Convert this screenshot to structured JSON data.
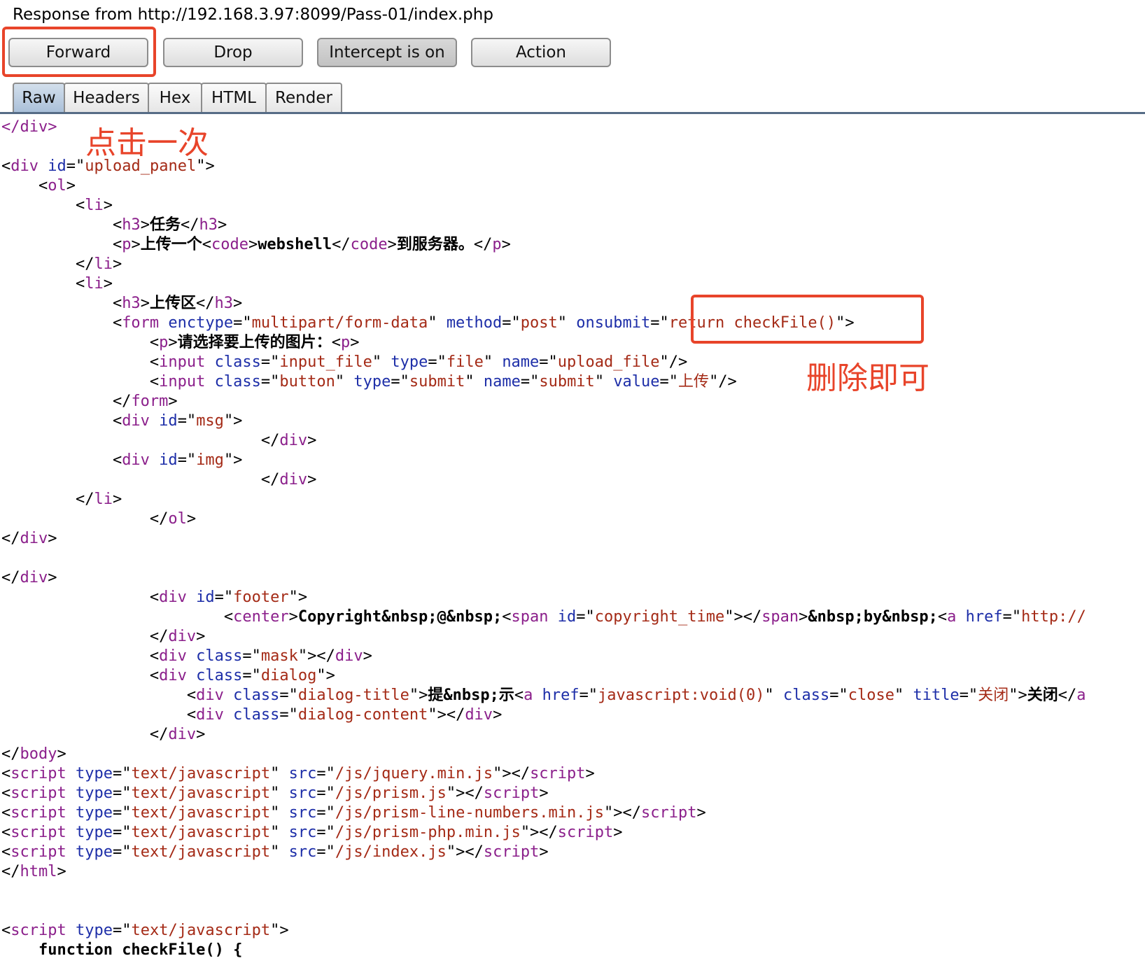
{
  "header": {
    "title": "Response from http://192.168.3.97:8099/Pass-01/index.php"
  },
  "toolbar": {
    "forward": "Forward",
    "drop": "Drop",
    "intercept": "Intercept is on",
    "action": "Action"
  },
  "tabs": [
    "Raw",
    "Headers",
    "Hex",
    "HTML",
    "Render"
  ],
  "annotations": {
    "click_once": "点击一次",
    "delete_it": "删除即可"
  },
  "colors": {
    "tag": "#8b1f8b",
    "attr": "#1d2ea8",
    "value": "#a42a16",
    "annotation": "#e8442a",
    "tab_active": "#aac0d9"
  },
  "code_lines": [
    [
      [
        "tg",
        "</div>"
      ]
    ],
    [],
    [
      [
        "pl",
        "<"
      ],
      [
        "tg",
        "div"
      ],
      [
        "pl",
        " "
      ],
      [
        "at",
        "id"
      ],
      [
        "pl",
        "=\""
      ],
      [
        "vl",
        "upload_panel"
      ],
      [
        "pl",
        "\">"
      ]
    ],
    [
      [
        "pl",
        "    <"
      ],
      [
        "tg",
        "ol"
      ],
      [
        "pl",
        ">"
      ]
    ],
    [
      [
        "pl",
        "        <"
      ],
      [
        "tg",
        "li"
      ],
      [
        "pl",
        ">"
      ]
    ],
    [
      [
        "pl",
        "            <"
      ],
      [
        "tg",
        "h3"
      ],
      [
        "pl",
        ">"
      ],
      [
        "tx",
        "任务"
      ],
      [
        "pl",
        "</"
      ],
      [
        "tg",
        "h3"
      ],
      [
        "pl",
        ">"
      ]
    ],
    [
      [
        "pl",
        "            <"
      ],
      [
        "tg",
        "p"
      ],
      [
        "pl",
        ">"
      ],
      [
        "tx",
        "上传一个"
      ],
      [
        "pl",
        "<"
      ],
      [
        "tg",
        "code"
      ],
      [
        "pl",
        ">"
      ],
      [
        "tx",
        "webshell"
      ],
      [
        "pl",
        "</"
      ],
      [
        "tg",
        "code"
      ],
      [
        "pl",
        ">"
      ],
      [
        "tx",
        "到服务器。"
      ],
      [
        "pl",
        "</"
      ],
      [
        "tg",
        "p"
      ],
      [
        "pl",
        ">"
      ]
    ],
    [
      [
        "pl",
        "        </"
      ],
      [
        "tg",
        "li"
      ],
      [
        "pl",
        ">"
      ]
    ],
    [
      [
        "pl",
        "        <"
      ],
      [
        "tg",
        "li"
      ],
      [
        "pl",
        ">"
      ]
    ],
    [
      [
        "pl",
        "            <"
      ],
      [
        "tg",
        "h3"
      ],
      [
        "pl",
        ">"
      ],
      [
        "tx",
        "上传区"
      ],
      [
        "pl",
        "</"
      ],
      [
        "tg",
        "h3"
      ],
      [
        "pl",
        ">"
      ]
    ],
    [
      [
        "pl",
        "            <"
      ],
      [
        "tg",
        "form"
      ],
      [
        "pl",
        " "
      ],
      [
        "at",
        "enctype"
      ],
      [
        "pl",
        "=\""
      ],
      [
        "vl",
        "multipart/form-data"
      ],
      [
        "pl",
        "\" "
      ],
      [
        "at",
        "method"
      ],
      [
        "pl",
        "=\""
      ],
      [
        "vl",
        "post"
      ],
      [
        "pl",
        "\" "
      ],
      [
        "at",
        "onsubmit"
      ],
      [
        "pl",
        "=\""
      ],
      [
        "vl",
        "return checkFile()"
      ],
      [
        "pl",
        "\">"
      ]
    ],
    [
      [
        "pl",
        "                <"
      ],
      [
        "tg",
        "p"
      ],
      [
        "pl",
        ">"
      ],
      [
        "tx",
        "请选择要上传的图片："
      ],
      [
        "pl",
        "<"
      ],
      [
        "tg",
        "p"
      ],
      [
        "pl",
        ">"
      ]
    ],
    [
      [
        "pl",
        "                <"
      ],
      [
        "tg",
        "input"
      ],
      [
        "pl",
        " "
      ],
      [
        "at",
        "class"
      ],
      [
        "pl",
        "=\""
      ],
      [
        "vl",
        "input_file"
      ],
      [
        "pl",
        "\" "
      ],
      [
        "at",
        "type"
      ],
      [
        "pl",
        "=\""
      ],
      [
        "vl",
        "file"
      ],
      [
        "pl",
        "\" "
      ],
      [
        "at",
        "name"
      ],
      [
        "pl",
        "=\""
      ],
      [
        "vl",
        "upload_file"
      ],
      [
        "pl",
        "\"/>"
      ]
    ],
    [
      [
        "pl",
        "                <"
      ],
      [
        "tg",
        "input"
      ],
      [
        "pl",
        " "
      ],
      [
        "at",
        "class"
      ],
      [
        "pl",
        "=\""
      ],
      [
        "vl",
        "button"
      ],
      [
        "pl",
        "\" "
      ],
      [
        "at",
        "type"
      ],
      [
        "pl",
        "=\""
      ],
      [
        "vl",
        "submit"
      ],
      [
        "pl",
        "\" "
      ],
      [
        "at",
        "name"
      ],
      [
        "pl",
        "=\""
      ],
      [
        "vl",
        "submit"
      ],
      [
        "pl",
        "\" "
      ],
      [
        "at",
        "value"
      ],
      [
        "pl",
        "=\""
      ],
      [
        "vl",
        "上传"
      ],
      [
        "pl",
        "\"/>"
      ]
    ],
    [
      [
        "pl",
        "            </"
      ],
      [
        "tg",
        "form"
      ],
      [
        "pl",
        ">"
      ]
    ],
    [
      [
        "pl",
        "            <"
      ],
      [
        "tg",
        "div"
      ],
      [
        "pl",
        " "
      ],
      [
        "at",
        "id"
      ],
      [
        "pl",
        "=\""
      ],
      [
        "vl",
        "msg"
      ],
      [
        "pl",
        "\">"
      ]
    ],
    [
      [
        "pl",
        "                            </"
      ],
      [
        "tg",
        "div"
      ],
      [
        "pl",
        ">"
      ]
    ],
    [
      [
        "pl",
        "            <"
      ],
      [
        "tg",
        "div"
      ],
      [
        "pl",
        " "
      ],
      [
        "at",
        "id"
      ],
      [
        "pl",
        "=\""
      ],
      [
        "vl",
        "img"
      ],
      [
        "pl",
        "\">"
      ]
    ],
    [
      [
        "pl",
        "                            </"
      ],
      [
        "tg",
        "div"
      ],
      [
        "pl",
        ">"
      ]
    ],
    [
      [
        "pl",
        "        </"
      ],
      [
        "tg",
        "li"
      ],
      [
        "pl",
        ">"
      ]
    ],
    [
      [
        "pl",
        "                </"
      ],
      [
        "tg",
        "ol"
      ],
      [
        "pl",
        ">"
      ]
    ],
    [
      [
        "pl",
        "</"
      ],
      [
        "tg",
        "div"
      ],
      [
        "pl",
        ">"
      ]
    ],
    [],
    [
      [
        "pl",
        "</"
      ],
      [
        "tg",
        "div"
      ],
      [
        "pl",
        ">"
      ]
    ],
    [
      [
        "pl",
        "                <"
      ],
      [
        "tg",
        "div"
      ],
      [
        "pl",
        " "
      ],
      [
        "at",
        "id"
      ],
      [
        "pl",
        "=\""
      ],
      [
        "vl",
        "footer"
      ],
      [
        "pl",
        "\">"
      ]
    ],
    [
      [
        "pl",
        "                        <"
      ],
      [
        "tg",
        "center"
      ],
      [
        "pl",
        ">"
      ],
      [
        "tx",
        "Copyright&nbsp;@&nbsp;"
      ],
      [
        "pl",
        "<"
      ],
      [
        "tg",
        "span"
      ],
      [
        "pl",
        " "
      ],
      [
        "at",
        "id"
      ],
      [
        "pl",
        "=\""
      ],
      [
        "vl",
        "copyright_time"
      ],
      [
        "pl",
        "\"></"
      ],
      [
        "tg",
        "span"
      ],
      [
        "pl",
        ">"
      ],
      [
        "tx",
        "&nbsp;by&nbsp;"
      ],
      [
        "pl",
        "<"
      ],
      [
        "tg",
        "a"
      ],
      [
        "pl",
        " "
      ],
      [
        "at",
        "href"
      ],
      [
        "pl",
        "=\""
      ],
      [
        "vl",
        "http://"
      ]
    ],
    [
      [
        "pl",
        "                </"
      ],
      [
        "tg",
        "div"
      ],
      [
        "pl",
        ">"
      ]
    ],
    [
      [
        "pl",
        "                <"
      ],
      [
        "tg",
        "div"
      ],
      [
        "pl",
        " "
      ],
      [
        "at",
        "class"
      ],
      [
        "pl",
        "=\""
      ],
      [
        "vl",
        "mask"
      ],
      [
        "pl",
        "\"></"
      ],
      [
        "tg",
        "div"
      ],
      [
        "pl",
        ">"
      ]
    ],
    [
      [
        "pl",
        "                <"
      ],
      [
        "tg",
        "div"
      ],
      [
        "pl",
        " "
      ],
      [
        "at",
        "class"
      ],
      [
        "pl",
        "=\""
      ],
      [
        "vl",
        "dialog"
      ],
      [
        "pl",
        "\">"
      ]
    ],
    [
      [
        "pl",
        "                    <"
      ],
      [
        "tg",
        "div"
      ],
      [
        "pl",
        " "
      ],
      [
        "at",
        "class"
      ],
      [
        "pl",
        "=\""
      ],
      [
        "vl",
        "dialog-title"
      ],
      [
        "pl",
        "\">"
      ],
      [
        "tx",
        "提&nbsp;示"
      ],
      [
        "pl",
        "<"
      ],
      [
        "tg",
        "a"
      ],
      [
        "pl",
        " "
      ],
      [
        "at",
        "href"
      ],
      [
        "pl",
        "=\""
      ],
      [
        "vl",
        "javascript:void(0)"
      ],
      [
        "pl",
        "\" "
      ],
      [
        "at",
        "class"
      ],
      [
        "pl",
        "=\""
      ],
      [
        "vl",
        "close"
      ],
      [
        "pl",
        "\" "
      ],
      [
        "at",
        "title"
      ],
      [
        "pl",
        "=\""
      ],
      [
        "vl",
        "关闭"
      ],
      [
        "pl",
        "\">"
      ],
      [
        "tx",
        "关闭"
      ],
      [
        "pl",
        "</"
      ],
      [
        "tg",
        "a"
      ]
    ],
    [
      [
        "pl",
        "                    <"
      ],
      [
        "tg",
        "div"
      ],
      [
        "pl",
        " "
      ],
      [
        "at",
        "class"
      ],
      [
        "pl",
        "=\""
      ],
      [
        "vl",
        "dialog-content"
      ],
      [
        "pl",
        "\"></"
      ],
      [
        "tg",
        "div"
      ],
      [
        "pl",
        ">"
      ]
    ],
    [
      [
        "pl",
        "                </"
      ],
      [
        "tg",
        "div"
      ],
      [
        "pl",
        ">"
      ]
    ],
    [
      [
        "pl",
        "</"
      ],
      [
        "tg",
        "body"
      ],
      [
        "pl",
        ">"
      ]
    ],
    [
      [
        "pl",
        "<"
      ],
      [
        "tg",
        "script"
      ],
      [
        "pl",
        " "
      ],
      [
        "at",
        "type"
      ],
      [
        "pl",
        "=\""
      ],
      [
        "vl",
        "text/javascript"
      ],
      [
        "pl",
        "\" "
      ],
      [
        "at",
        "src"
      ],
      [
        "pl",
        "=\""
      ],
      [
        "vl",
        "/js/jquery.min.js"
      ],
      [
        "pl",
        "\"></"
      ],
      [
        "tg",
        "script"
      ],
      [
        "pl",
        ">"
      ]
    ],
    [
      [
        "pl",
        "<"
      ],
      [
        "tg",
        "script"
      ],
      [
        "pl",
        " "
      ],
      [
        "at",
        "type"
      ],
      [
        "pl",
        "=\""
      ],
      [
        "vl",
        "text/javascript"
      ],
      [
        "pl",
        "\" "
      ],
      [
        "at",
        "src"
      ],
      [
        "pl",
        "=\""
      ],
      [
        "vl",
        "/js/prism.js"
      ],
      [
        "pl",
        "\"></"
      ],
      [
        "tg",
        "script"
      ],
      [
        "pl",
        ">"
      ]
    ],
    [
      [
        "pl",
        "<"
      ],
      [
        "tg",
        "script"
      ],
      [
        "pl",
        " "
      ],
      [
        "at",
        "type"
      ],
      [
        "pl",
        "=\""
      ],
      [
        "vl",
        "text/javascript"
      ],
      [
        "pl",
        "\" "
      ],
      [
        "at",
        "src"
      ],
      [
        "pl",
        "=\""
      ],
      [
        "vl",
        "/js/prism-line-numbers.min.js"
      ],
      [
        "pl",
        "\"></"
      ],
      [
        "tg",
        "script"
      ],
      [
        "pl",
        ">"
      ]
    ],
    [
      [
        "pl",
        "<"
      ],
      [
        "tg",
        "script"
      ],
      [
        "pl",
        " "
      ],
      [
        "at",
        "type"
      ],
      [
        "pl",
        "=\""
      ],
      [
        "vl",
        "text/javascript"
      ],
      [
        "pl",
        "\" "
      ],
      [
        "at",
        "src"
      ],
      [
        "pl",
        "=\""
      ],
      [
        "vl",
        "/js/prism-php.min.js"
      ],
      [
        "pl",
        "\"></"
      ],
      [
        "tg",
        "script"
      ],
      [
        "pl",
        ">"
      ]
    ],
    [
      [
        "pl",
        "<"
      ],
      [
        "tg",
        "script"
      ],
      [
        "pl",
        " "
      ],
      [
        "at",
        "type"
      ],
      [
        "pl",
        "=\""
      ],
      [
        "vl",
        "text/javascript"
      ],
      [
        "pl",
        "\" "
      ],
      [
        "at",
        "src"
      ],
      [
        "pl",
        "=\""
      ],
      [
        "vl",
        "/js/index.js"
      ],
      [
        "pl",
        "\"></"
      ],
      [
        "tg",
        "script"
      ],
      [
        "pl",
        ">"
      ]
    ],
    [
      [
        "pl",
        "</"
      ],
      [
        "tg",
        "html"
      ],
      [
        "pl",
        ">"
      ]
    ],
    [],
    [],
    [
      [
        "pl",
        "<"
      ],
      [
        "tg",
        "script"
      ],
      [
        "pl",
        " "
      ],
      [
        "at",
        "type"
      ],
      [
        "pl",
        "=\""
      ],
      [
        "vl",
        "text/javascript"
      ],
      [
        "pl",
        "\">"
      ]
    ],
    [
      [
        "pl",
        "    "
      ],
      [
        "tx",
        "function checkFile() {"
      ]
    ]
  ]
}
